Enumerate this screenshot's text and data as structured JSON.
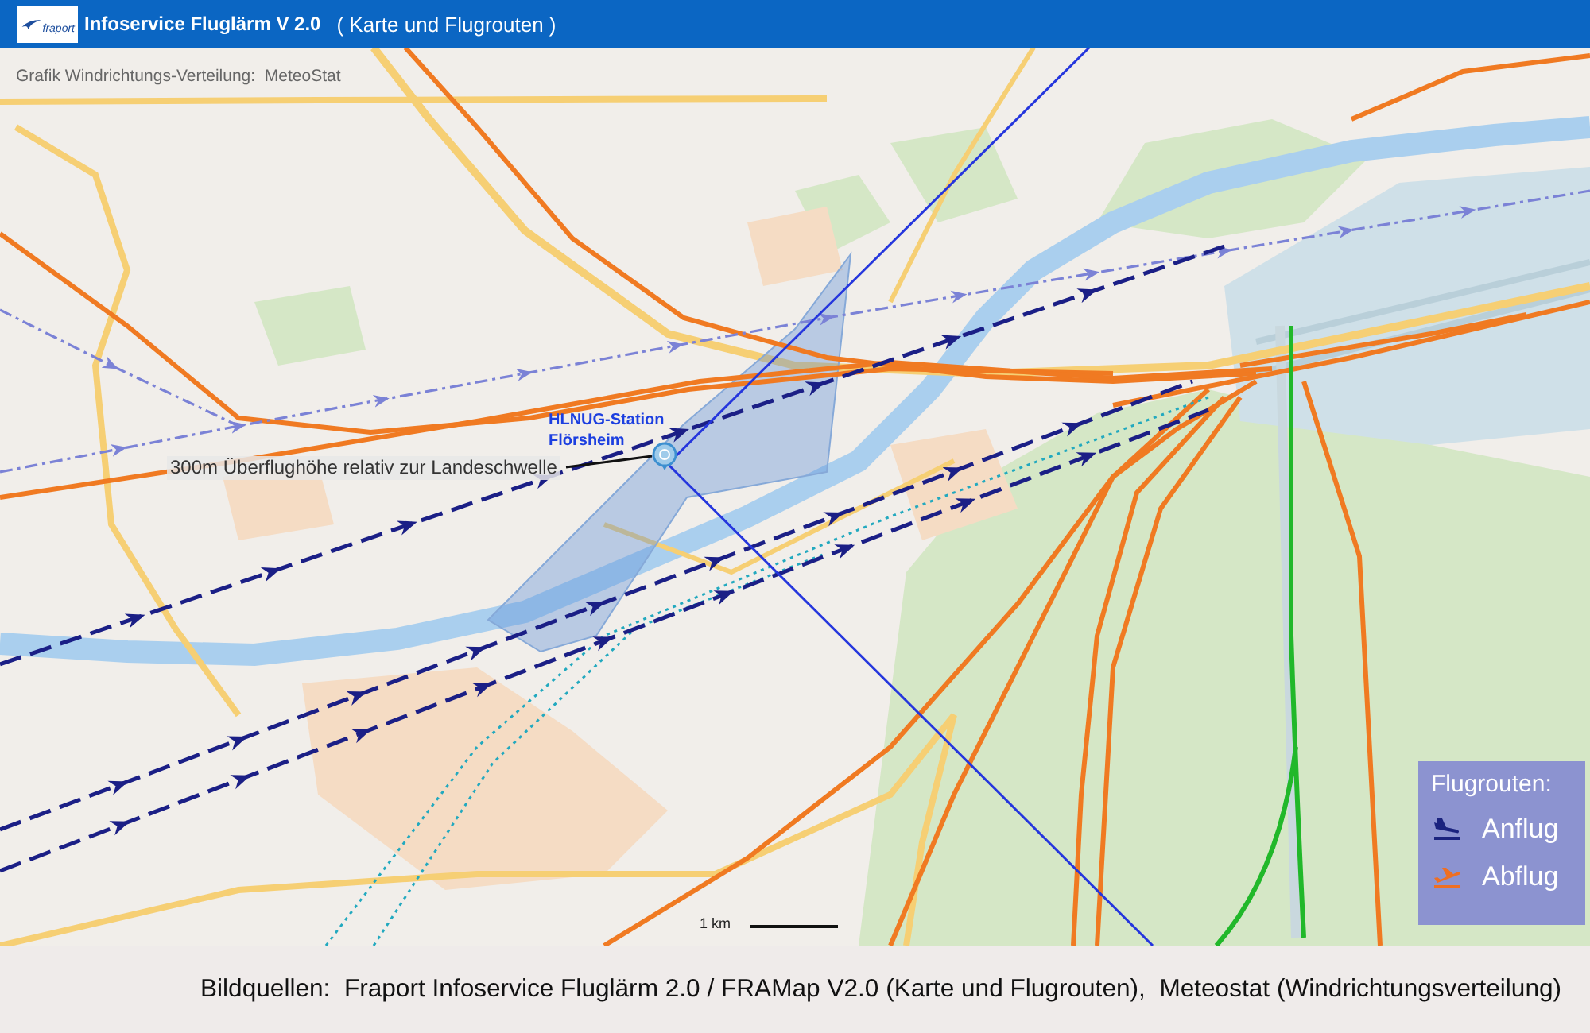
{
  "header": {
    "logo_text": "fraport",
    "title": "Infoservice Fluglärm V 2.0",
    "subtitle": "( Karte und Flugrouten )"
  },
  "map": {
    "wind_note": "Grafik Windrichtungs-Verteilung:  MeteoStat",
    "station_label": "HLNUG-Station\nFlörsheim",
    "height_note": "300m Überflughöhe relativ zur Landeschwelle",
    "scale_label": "1 km",
    "legend": {
      "title": "Flugrouten:",
      "items": [
        {
          "kind": "arrival",
          "label": "Anflug"
        },
        {
          "kind": "departure",
          "label": "Abflug"
        }
      ]
    }
  },
  "caption": "Bildquellen:  Fraport Infoservice Fluglärm 2.0 / FRAMap V2.0 (Karte und Flugrouten),  Meteostat (Windrichtungsverteilung)"
}
